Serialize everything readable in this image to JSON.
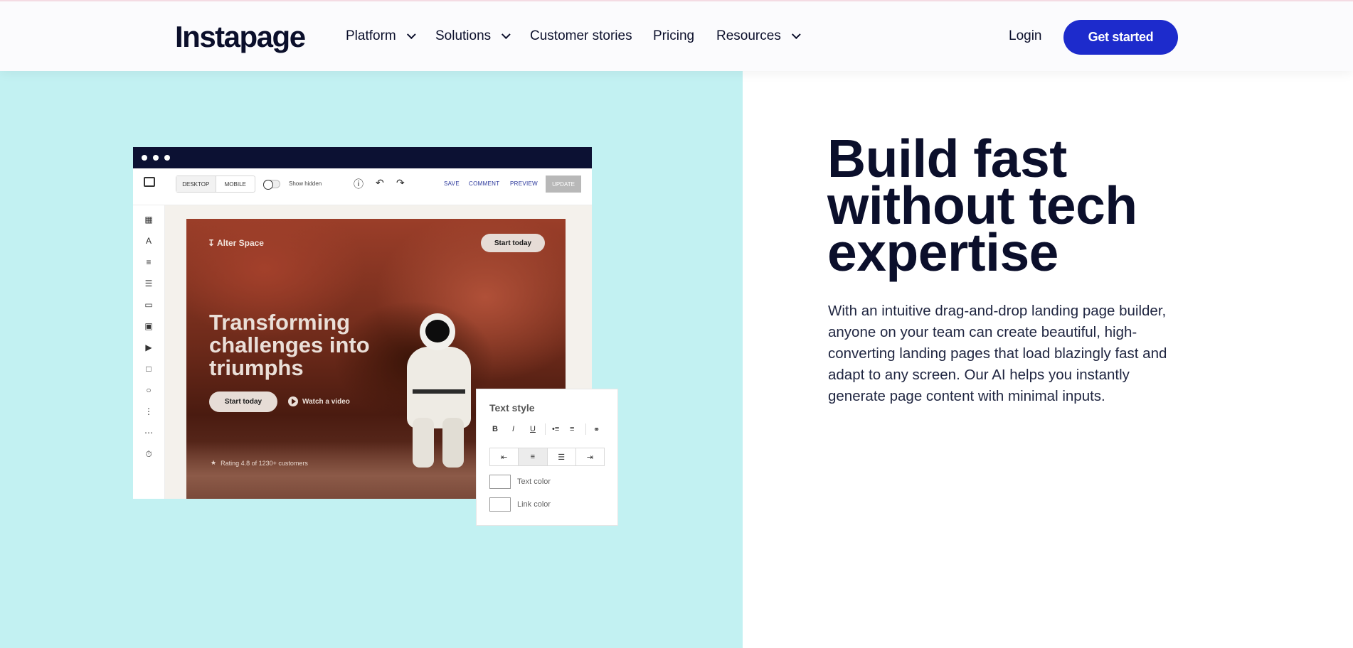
{
  "nav": {
    "logo": "Instapage",
    "items": [
      {
        "label": "Platform",
        "dropdown": true
      },
      {
        "label": "Solutions",
        "dropdown": true
      },
      {
        "label": "Customer stories",
        "dropdown": false
      },
      {
        "label": "Pricing",
        "dropdown": false
      },
      {
        "label": "Resources",
        "dropdown": true
      }
    ],
    "login": "Login",
    "cta": "Get started"
  },
  "editor": {
    "view_modes": [
      "DESKTOP",
      "MOBILE"
    ],
    "show_hidden": "Show hidden",
    "actions": [
      "SAVE",
      "COMMENT",
      "PREVIEW"
    ],
    "update": "UPDATE",
    "side_icons": [
      "section-icon",
      "headline-icon",
      "paragraph-icon",
      "list-icon",
      "button-icon",
      "image-icon",
      "video-icon",
      "box-icon",
      "shape-icon",
      "form-icon",
      "divider-icon",
      "timer-icon"
    ]
  },
  "mock_page": {
    "brand": "Alter Space",
    "top_button": "Start today",
    "title": "Transforming challenges into triumphs",
    "primary_button": "Start today",
    "secondary_link": "Watch a video",
    "rating": "Rating 4.8 of 1230+ customers"
  },
  "text_style": {
    "title": "Text style",
    "formats": [
      "B",
      "I",
      "U"
    ],
    "text_color": "Text color",
    "link_color": "Link color"
  },
  "content": {
    "headline": "Build fast without tech expertise",
    "body": "With an intuitive drag-and-drop landing page builder, anyone on your team can create beautiful, high-converting landing pages that load blazingly fast and adapt to any screen. Our AI helps you instantly generate page content with minimal inputs."
  },
  "colors": {
    "accent": "#1d2bcc",
    "panel": "#c2f1f2",
    "ink": "#0b0f2b"
  }
}
